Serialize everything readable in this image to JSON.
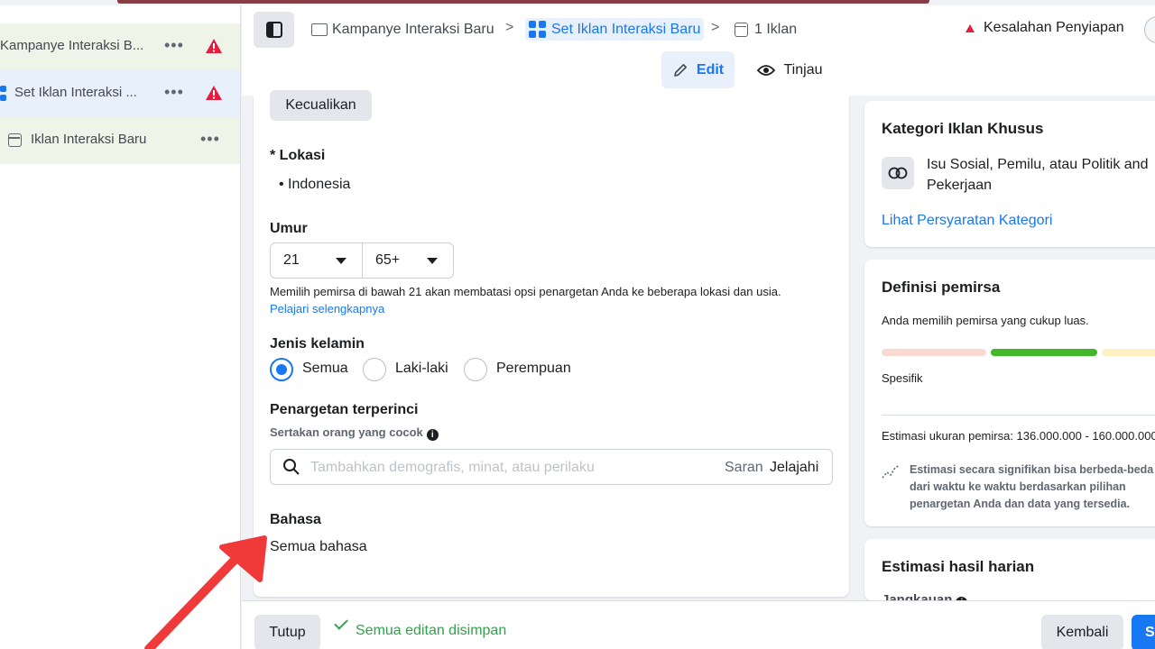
{
  "sidebar": {
    "items": [
      {
        "label": "Kampanye Interaksi B...",
        "more": "•••"
      },
      {
        "label": "Set Iklan Interaksi ...",
        "more": "•••"
      },
      {
        "label": "Iklan Interaksi Baru",
        "more": "•••"
      }
    ]
  },
  "header": {
    "breadcrumbs": [
      "Kampanye Interaksi Baru",
      "Set Iklan Interaksi Baru",
      "1 Iklan"
    ],
    "separator": ">",
    "setup_error": "Kesalahan Penyiapan",
    "edit_label": "Edit",
    "review_label": "Tinjau"
  },
  "form": {
    "exclude_label": "Kecualikan",
    "location_title": "* Lokasi",
    "location_value": "• Indonesia",
    "age_title": "Umur",
    "age_min": "21",
    "age_max": "65+",
    "age_note": "Memilih pemirsa di bawah 21 akan membatasi opsi penargetan Anda ke beberapa lokasi dan usia.",
    "learn_more": "Pelajari selengkapnya",
    "gender_title": "Jenis kelamin",
    "gender_options": [
      "Semua",
      "Laki-laki",
      "Perempuan"
    ],
    "gender_selected": "Semua",
    "detailed_title": "Penargetan terperinci",
    "detailed_subtitle": "Sertakan orang yang cocok",
    "search_placeholder": "Tambahkan demografis, minat, atau perilaku",
    "suggest_label": "Saran",
    "browse_label": "Jelajahi",
    "language_title": "Bahasa",
    "language_value": "Semua bahasa"
  },
  "special_category": {
    "title": "Kategori Iklan Khusus",
    "description": "Isu Sosial, Pemilu, atau Politik and Pekerjaan",
    "link": "Lihat Persyaratan Kategori"
  },
  "audience": {
    "title": "Definisi pemirsa",
    "summary": "Anda memilih pemirsa yang cukup luas.",
    "scale_label": "Spesifik",
    "estimate": "Estimasi ukuran pemirsa: 136.000.000 - 160.000.000",
    "note": "Estimasi secara signifikan bisa berbeda-beda dari waktu ke waktu berdasarkan pilihan penargetan Anda dan data yang tersedia.",
    "colors": {
      "low": "#fbd9d3",
      "mid": "#42b72a",
      "high": "#fff0c4"
    }
  },
  "daily_results": {
    "title": "Estimasi hasil harian",
    "reach_label": "Jangkauan"
  },
  "footer": {
    "close_label": "Tutup",
    "saved_status": "Semua editan disimpan",
    "back_label": "Kembali",
    "submit_label": "S"
  },
  "icons": [
    "sidebar-toggle-icon",
    "folder-icon",
    "grid-icon",
    "document-icon",
    "warning-icon",
    "edit-pencil-icon",
    "eye-icon",
    "search-icon",
    "info-icon",
    "overlap-circles-icon",
    "trend-icon",
    "check-icon",
    "caret-down-icon",
    "annotation-arrow-icon"
  ]
}
